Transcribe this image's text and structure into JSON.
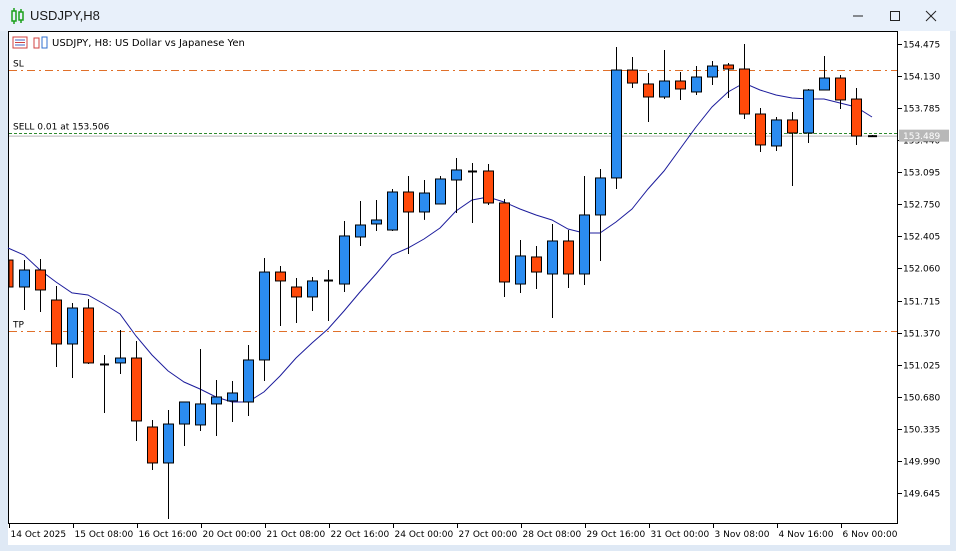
{
  "window": {
    "title": "USDJPY,H8",
    "app_icon": "candlestick-chart-icon",
    "buttons": [
      "minimize-icon",
      "maximize-icon",
      "close-icon"
    ]
  },
  "chart_header": {
    "text": "USDJPY, H8:  US Dollar vs Japanese Yen"
  },
  "levels": {
    "sl": {
      "label": "SL",
      "price": 154.195,
      "color": "#e0702a"
    },
    "tp": {
      "label": "TP",
      "price": 151.388,
      "color": "#e0702a"
    },
    "order": {
      "label": "SELL 0.01 at 153.506",
      "price": 153.506,
      "color": "#2e8b2e"
    },
    "current": {
      "label": "153.489",
      "price": 153.489,
      "color": "#b8b8b8"
    }
  },
  "colors": {
    "bull": "#2b8cf0",
    "bear": "#ff4a0a",
    "ma": "#1c1c9c",
    "outline": "#000000"
  },
  "chart_data": {
    "type": "candlestick",
    "symbol": "USDJPY",
    "timeframe": "H8",
    "ylim": [
      149.3,
      154.6
    ],
    "y_ticks": [
      "154.475",
      "154.130",
      "153.785",
      "153.440",
      "153.095",
      "152.750",
      "152.405",
      "152.060",
      "151.715",
      "151.370",
      "151.025",
      "150.680",
      "150.335",
      "149.990",
      "149.645"
    ],
    "x_ticks": [
      {
        "index": 0,
        "label": "14 Oct 2025"
      },
      {
        "index": 4,
        "label": "15 Oct 08:00"
      },
      {
        "index": 8,
        "label": "16 Oct 16:00"
      },
      {
        "index": 12,
        "label": "20 Oct 00:00"
      },
      {
        "index": 16,
        "label": "21 Oct 08:00"
      },
      {
        "index": 20,
        "label": "22 Oct 16:00"
      },
      {
        "index": 24,
        "label": "24 Oct 00:00"
      },
      {
        "index": 28,
        "label": "27 Oct 00:00"
      },
      {
        "index": 32,
        "label": "28 Oct 08:00"
      },
      {
        "index": 36,
        "label": "29 Oct 16:00"
      },
      {
        "index": 40,
        "label": "31 Oct 00:00"
      },
      {
        "index": 44,
        "label": "3 Nov 08:00"
      },
      {
        "index": 48,
        "label": "4 Nov 16:00"
      },
      {
        "index": 52,
        "label": "6 Nov 00:00"
      }
    ],
    "ohlc": [
      [
        152.151,
        152.18,
        151.84,
        151.861
      ],
      [
        151.861,
        152.151,
        151.614,
        152.044
      ],
      [
        152.044,
        152.162,
        151.592,
        151.829
      ],
      [
        151.721,
        151.872,
        151.0,
        151.248
      ],
      [
        151.248,
        151.689,
        150.882,
        151.635
      ],
      [
        151.635,
        151.732,
        151.033,
        151.044
      ],
      [
        151.033,
        151.13,
        150.506,
        151.033
      ],
      [
        151.044,
        151.399,
        150.925,
        151.097
      ],
      [
        151.097,
        151.28,
        150.205,
        150.42
      ],
      [
        150.355,
        150.43,
        149.893,
        149.968
      ],
      [
        149.968,
        150.538,
        149.365,
        150.387
      ],
      [
        150.387,
        150.624,
        150.151,
        150.624
      ],
      [
        150.377,
        151.194,
        150.312,
        150.603
      ],
      [
        150.603,
        150.861,
        150.258,
        150.678
      ],
      [
        150.635,
        150.85,
        150.409,
        150.721
      ],
      [
        150.624,
        151.237,
        150.473,
        151.076
      ],
      [
        151.076,
        152.173,
        150.85,
        152.022
      ],
      [
        152.022,
        152.087,
        151.442,
        151.926
      ],
      [
        151.861,
        151.958,
        151.474,
        151.754
      ],
      [
        151.754,
        151.969,
        151.603,
        151.926
      ],
      [
        151.926,
        152.044,
        151.495,
        151.936
      ],
      [
        151.893,
        152.571,
        151.807,
        152.41
      ],
      [
        152.399,
        152.786,
        152.302,
        152.528
      ],
      [
        152.539,
        152.797,
        152.464,
        152.582
      ],
      [
        152.474,
        152.915,
        152.464,
        152.883
      ],
      [
        152.883,
        153.055,
        152.216,
        152.668
      ],
      [
        152.668,
        153.012,
        152.583,
        152.872
      ],
      [
        152.754,
        153.055,
        152.754,
        153.023
      ],
      [
        153.012,
        153.249,
        152.657,
        153.12
      ],
      [
        153.109,
        153.195,
        152.55,
        153.109
      ],
      [
        153.109,
        153.184,
        152.743,
        152.765
      ],
      [
        152.765,
        152.808,
        151.754,
        151.915
      ],
      [
        151.893,
        152.367,
        151.797,
        152.195
      ],
      [
        152.184,
        152.302,
        151.84,
        152.022
      ],
      [
        152.001,
        152.539,
        151.528,
        152.356
      ],
      [
        152.356,
        152.474,
        151.85,
        152.001
      ],
      [
        152.001,
        153.055,
        151.883,
        152.636
      ],
      [
        152.636,
        153.13,
        152.141,
        153.034
      ],
      [
        153.034,
        154.443,
        152.915,
        154.195
      ],
      [
        154.195,
        154.335,
        154.002,
        154.055
      ],
      [
        154.045,
        154.163,
        153.636,
        153.905
      ],
      [
        153.905,
        154.41,
        153.883,
        154.077
      ],
      [
        154.077,
        154.174,
        153.873,
        153.991
      ],
      [
        153.959,
        154.238,
        153.926,
        154.12
      ],
      [
        154.12,
        154.292,
        154.034,
        154.238
      ],
      [
        154.249,
        154.271,
        153.894,
        154.206
      ],
      [
        154.206,
        154.475,
        153.668,
        153.722
      ],
      [
        153.722,
        153.787,
        153.313,
        153.389
      ],
      [
        153.378,
        153.69,
        153.324,
        153.658
      ],
      [
        153.658,
        153.744,
        152.948,
        153.518
      ],
      [
        153.518,
        153.991,
        153.41,
        153.98
      ],
      [
        153.98,
        154.346,
        153.98,
        154.109
      ],
      [
        154.109,
        154.142,
        153.776,
        153.873
      ],
      [
        153.883,
        154.002,
        153.389,
        153.485
      ],
      [
        153.489,
        153.496,
        153.475,
        153.489
      ]
    ],
    "moving_average": [
      152.281,
      152.205,
      152.044,
      151.915,
      151.797,
      151.775,
      151.678,
      151.571,
      151.334,
      151.13,
      150.958,
      150.839,
      150.764,
      150.678,
      150.624,
      150.624,
      150.732,
      150.904,
      151.097,
      151.259,
      151.409,
      151.603,
      151.807,
      152.001,
      152.205,
      152.281,
      152.377,
      152.496,
      152.679,
      152.797,
      152.829,
      152.775,
      152.7,
      152.636,
      152.582,
      152.485,
      152.442,
      152.442,
      152.56,
      152.7,
      152.915,
      153.109,
      153.346,
      153.582,
      153.797,
      153.959,
      154.055,
      153.98,
      153.926,
      153.894,
      153.883,
      153.883,
      153.84,
      153.797,
      153.69
    ]
  }
}
